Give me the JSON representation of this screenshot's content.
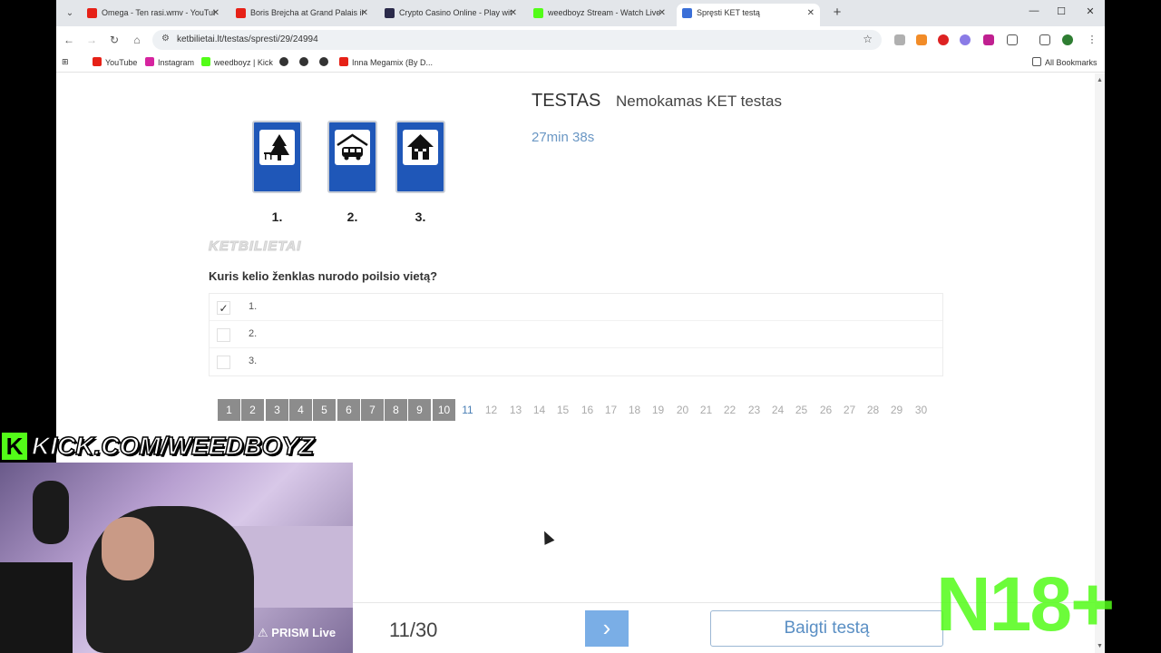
{
  "browser": {
    "tabs": [
      {
        "title": "Omega - Ten rasi.wmv - YouTub",
        "favicon_color": "#e62117"
      },
      {
        "title": "Boris Brejcha at Grand Palais in",
        "favicon_color": "#e62117"
      },
      {
        "title": "Crypto Casino Online - Play wit",
        "favicon_color": "#2a2a4a"
      },
      {
        "title": "weedboyz Stream - Watch Live",
        "favicon_color": "#53fc18"
      },
      {
        "title": "Spręsti KET testą",
        "favicon_color": "#3a6fd8"
      }
    ],
    "active_tab_index": 4,
    "url": "ketbilietai.lt/testas/spresti/29/24994",
    "bookmarks": [
      {
        "label": "YouTube",
        "icon_color": "#e62117"
      },
      {
        "label": "Instagram",
        "icon_color": "#d6249f"
      },
      {
        "label": "weedboyz | Kick",
        "icon_color": "#53fc18"
      },
      {
        "label": "",
        "icon_color": "#333333"
      },
      {
        "label": "",
        "icon_color": "#333333"
      },
      {
        "label": "",
        "icon_color": "#333333"
      },
      {
        "label": "Inna Megamix (By D...",
        "icon_color": "#e62117"
      }
    ],
    "all_bookmarks_label": "All Bookmarks"
  },
  "test": {
    "title": "TESTAS",
    "subtitle": "Nemokamas KET testas",
    "timer": "27min 38s",
    "watermark": "KETBILIETAI",
    "sign_numbers": [
      "1.",
      "2.",
      "3."
    ],
    "question": "Kuris kelio ženklas nurodo poilsio vietą?",
    "answers": [
      {
        "label": "1.",
        "checked": true
      },
      {
        "label": "2.",
        "checked": false
      },
      {
        "label": "3.",
        "checked": false
      }
    ],
    "pages": [
      "1",
      "2",
      "3",
      "4",
      "5",
      "6",
      "7",
      "8",
      "9",
      "10",
      "11",
      "12",
      "13",
      "14",
      "15",
      "16",
      "17",
      "18",
      "19",
      "20",
      "21",
      "22",
      "23",
      "24",
      "25",
      "26",
      "27",
      "28",
      "29",
      "30"
    ],
    "answered_count": 10,
    "current_page": 11,
    "counter": "11/30",
    "next_label": "›",
    "finish_label": "Baigti testą"
  },
  "overlay": {
    "kick_logo": "K",
    "kick_text": "KICK.COM/WEEDBOYZ",
    "prism_label": "PRISM Live",
    "age_badge": "N18+"
  },
  "colors": {
    "accent_blue": "#6a97c4",
    "next_button": "#7aaee6",
    "answered_page": "#8c8c8c",
    "sign_blue": "#1f57b8",
    "kick_green": "#53fc18"
  }
}
